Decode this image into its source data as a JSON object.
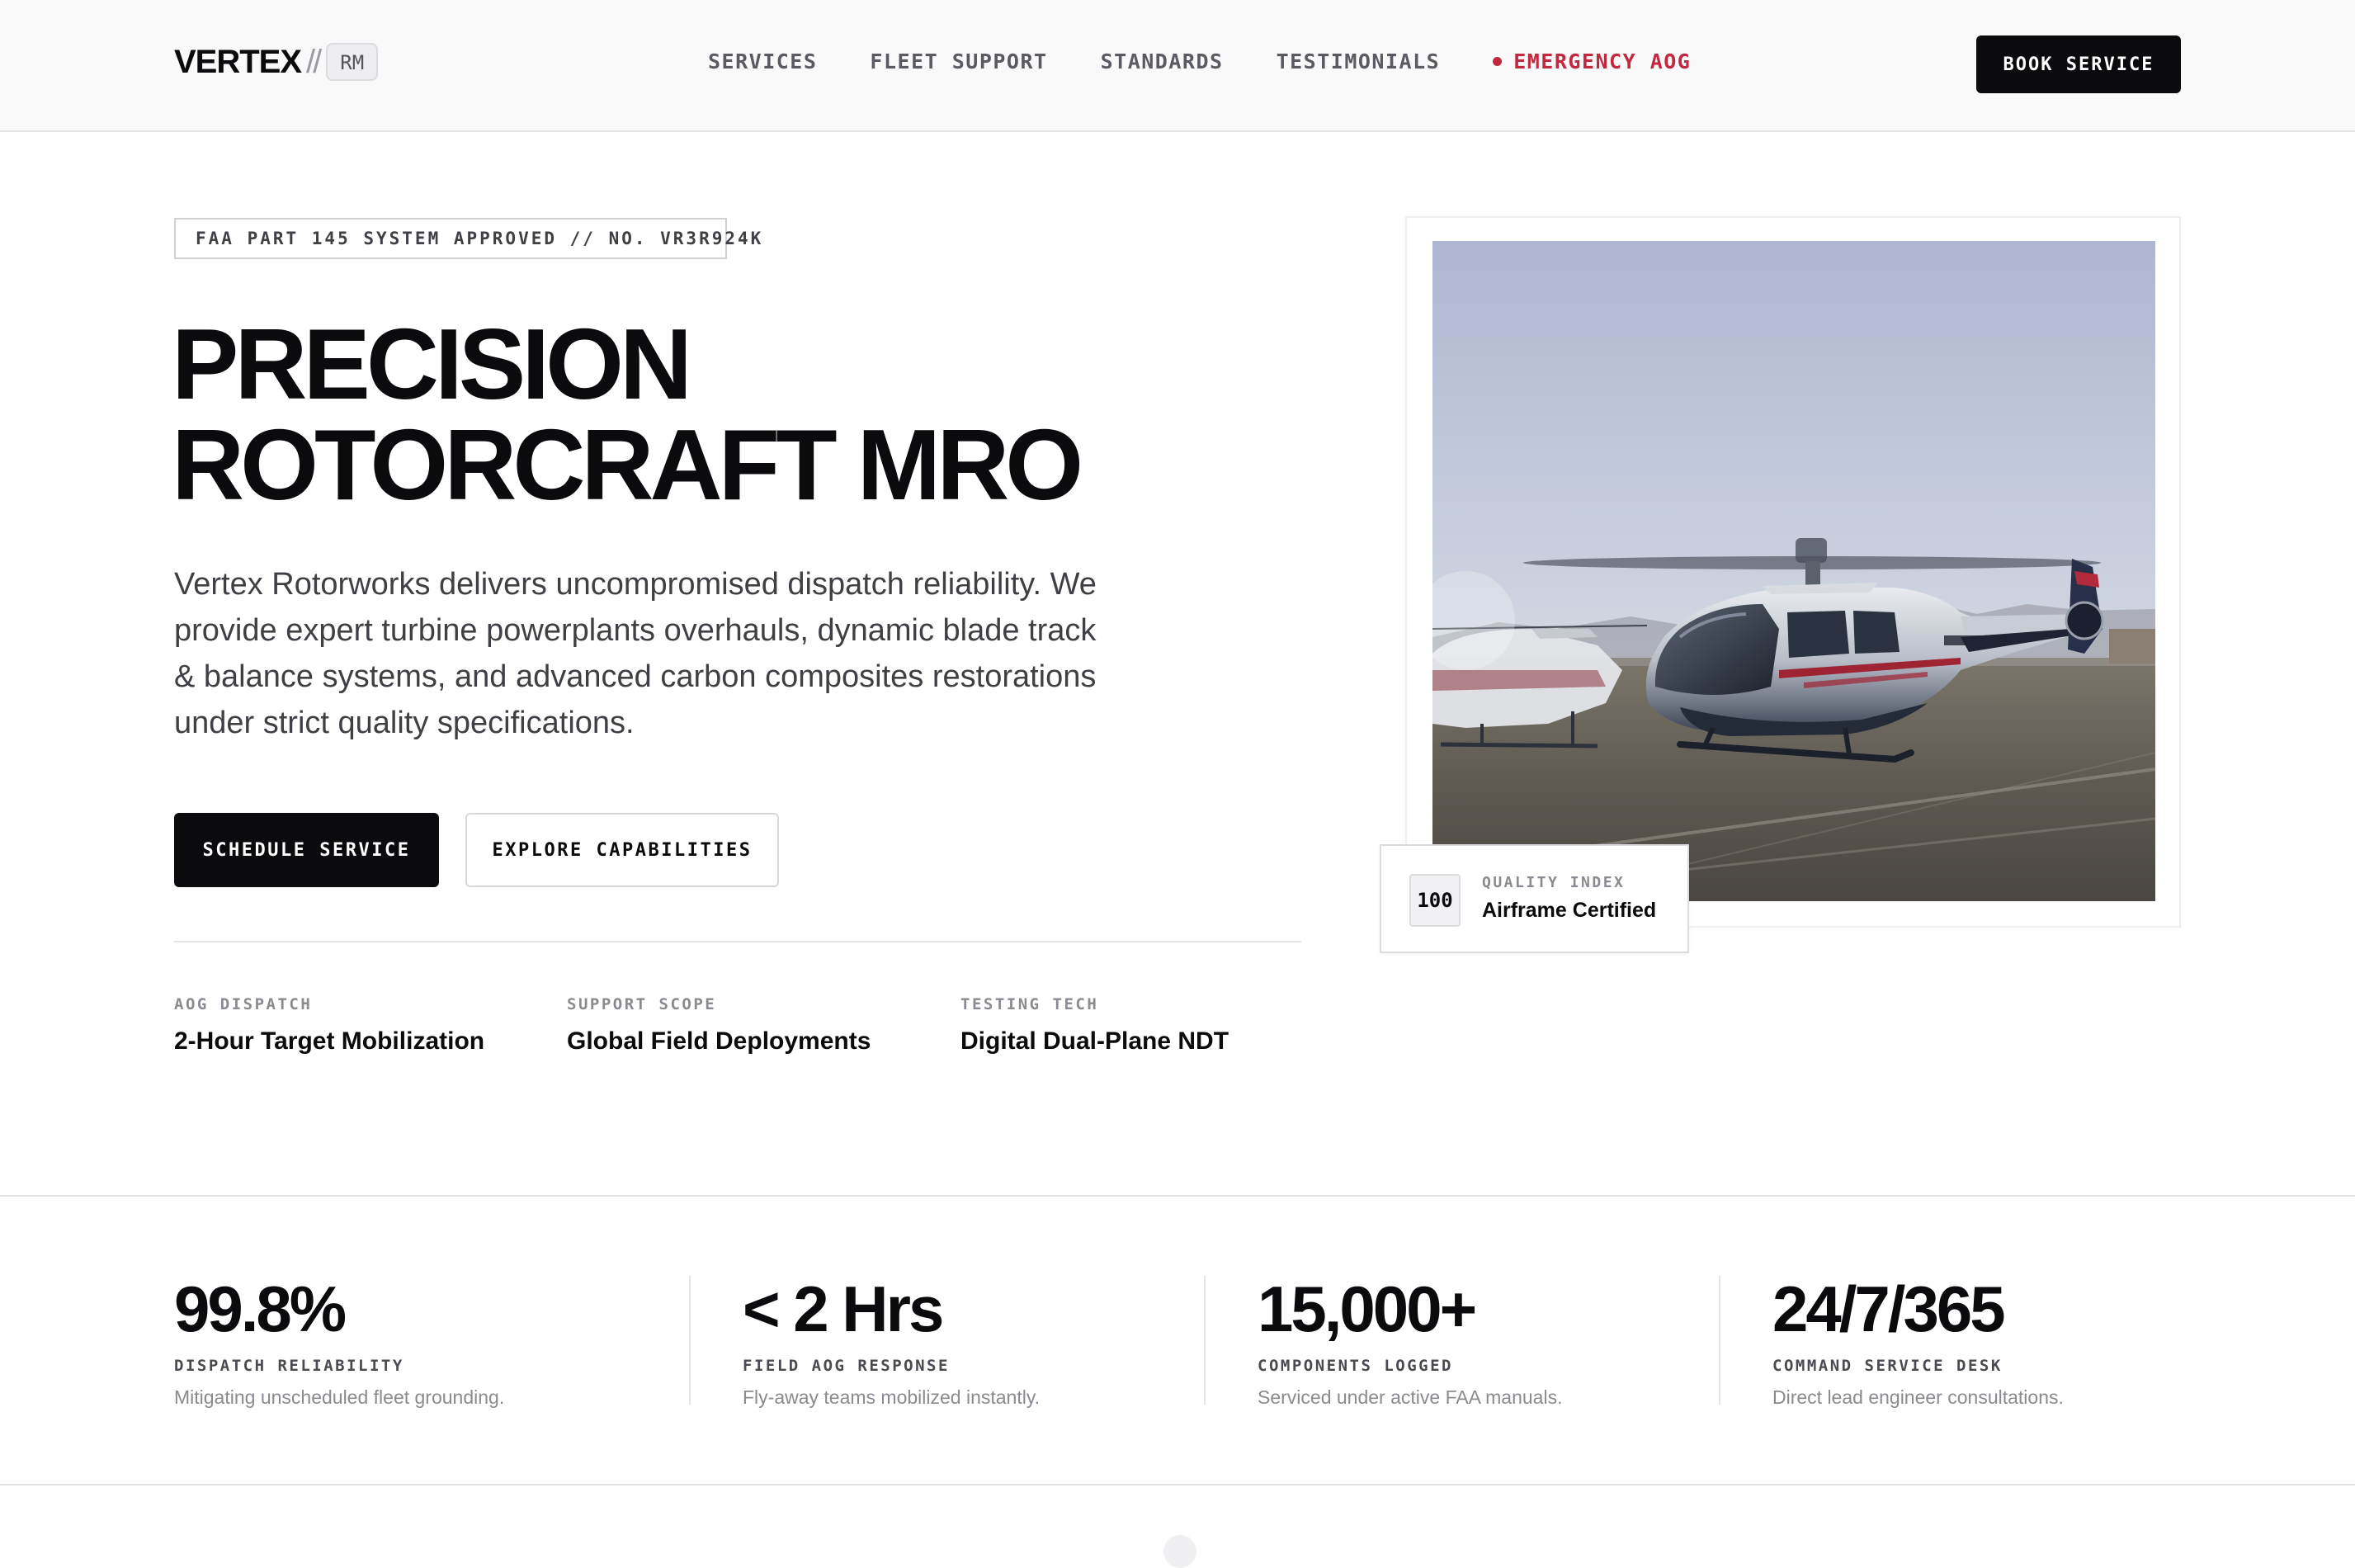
{
  "header": {
    "logo_word": "VERTEX",
    "logo_separator": "//",
    "logo_badge": "RM",
    "nav": [
      {
        "label": "SERVICES"
      },
      {
        "label": "FLEET SUPPORT"
      },
      {
        "label": "STANDARDS"
      },
      {
        "label": "TESTIMONIALS"
      },
      {
        "label": "EMERGENCY AOG"
      }
    ],
    "cta_label": "BOOK SERVICE"
  },
  "hero": {
    "cert_tag": "FAA PART 145 SYSTEM APPROVED // NO. VR3R924K",
    "title_line1": "PRECISION",
    "title_line2": "ROTORCRAFT MRO",
    "description": "Vertex Rotorworks delivers uncompromised dispatch reliability. We provide expert turbine powerplants overhauls, dynamic blade track & balance systems, and advanced carbon composites restorations under strict quality specifications.",
    "primary_button": "SCHEDULE SERVICE",
    "secondary_button": "EXPLORE CAPABILITIES",
    "features": [
      {
        "label": "AOG DISPATCH",
        "value": "2-Hour Target Mobilization"
      },
      {
        "label": "SUPPORT SCOPE",
        "value": "Global Field Deployments"
      },
      {
        "label": "TESTING TECH",
        "value": "Digital Dual-Plane NDT"
      }
    ],
    "quality_card": {
      "score": "100",
      "label": "QUALITY INDEX",
      "value": "Airframe Certified"
    }
  },
  "stats": [
    {
      "value": "99.8%",
      "label": "DISPATCH RELIABILITY",
      "desc": "Mitigating unscheduled fleet grounding."
    },
    {
      "value": "< 2 Hrs",
      "label": "FIELD AOG RESPONSE",
      "desc": "Fly-away teams mobilized instantly."
    },
    {
      "value": "15,000+",
      "label": "COMPONENTS LOGGED",
      "desc": "Serviced under active FAA manuals."
    },
    {
      "value": "24/7/365",
      "label": "COMMAND SERVICE DESK",
      "desc": "Direct lead engineer consultations."
    }
  ],
  "colors": {
    "ink": "#0b0b0d",
    "accent_red": "#c2283f",
    "muted": "#8a8a92",
    "border": "#e4e4e7"
  }
}
